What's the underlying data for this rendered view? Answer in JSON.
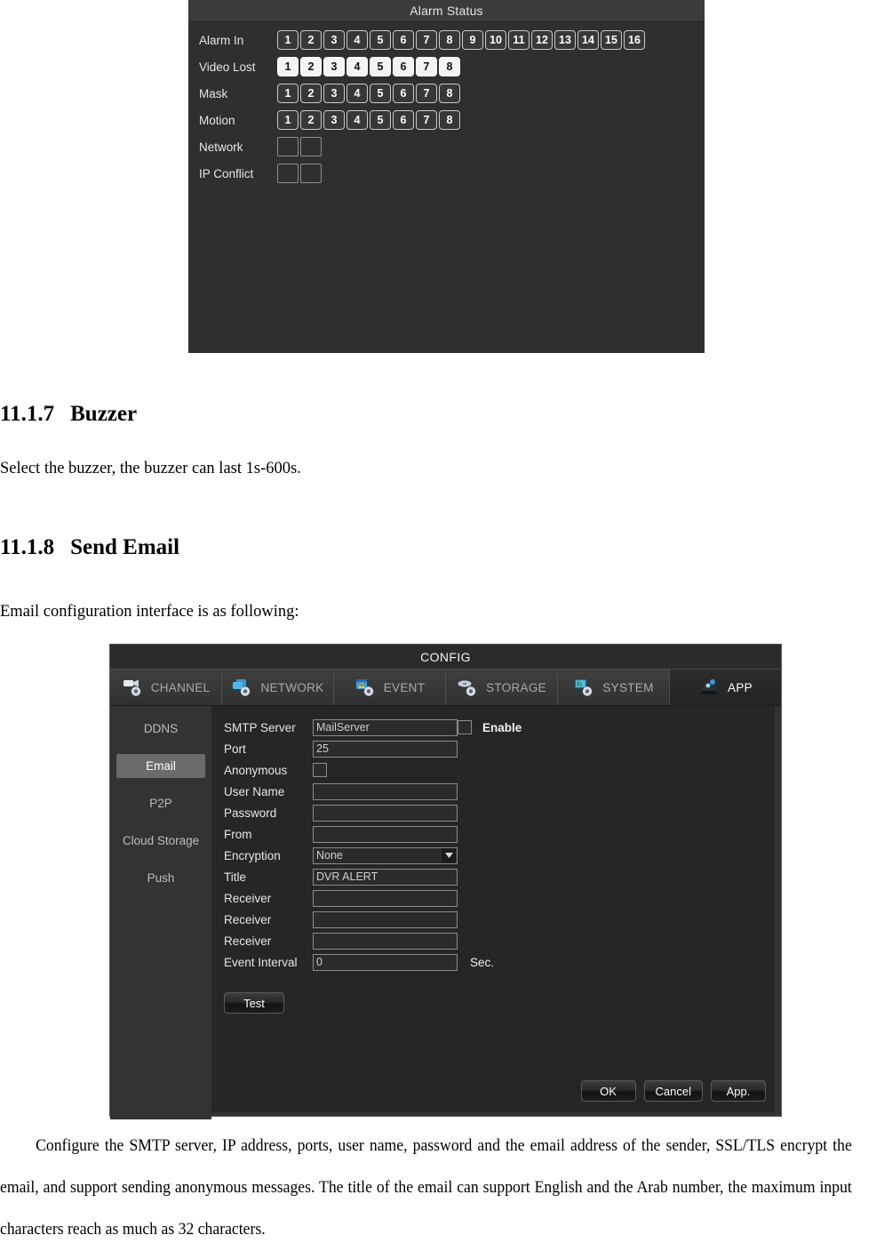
{
  "alarm_status": {
    "title": "Alarm Status",
    "rows": [
      {
        "label": "Alarm In",
        "type": "chips",
        "items": [
          "1",
          "2",
          "3",
          "4",
          "5",
          "6",
          "7",
          "8",
          "9",
          "10",
          "11",
          "12",
          "13",
          "14",
          "15",
          "16"
        ],
        "active": []
      },
      {
        "label": "Video Lost",
        "type": "chips",
        "items": [
          "1",
          "2",
          "3",
          "4",
          "5",
          "6",
          "7",
          "8"
        ],
        "active": [
          1,
          2,
          3,
          4,
          5,
          6,
          7,
          8
        ]
      },
      {
        "label": "Mask",
        "type": "chips",
        "items": [
          "1",
          "2",
          "3",
          "4",
          "5",
          "6",
          "7",
          "8"
        ],
        "active": []
      },
      {
        "label": "Motion",
        "type": "chips",
        "items": [
          "1",
          "2",
          "3",
          "4",
          "5",
          "6",
          "7",
          "8"
        ],
        "active": []
      },
      {
        "label": "Network",
        "type": "blanks",
        "count": 2
      },
      {
        "label": "IP Conflict",
        "type": "blanks",
        "count": 2
      }
    ]
  },
  "document": {
    "section_buzzer": {
      "number": "11.1.7",
      "title": "Buzzer"
    },
    "para_buzzer": "Select the buzzer, the buzzer can last 1s-600s.",
    "section_email": {
      "number": "11.1.8",
      "title": "Send Email"
    },
    "para_email": "Email configuration interface is as following:",
    "closing_para": "Configure the SMTP server, IP address, ports, user name, password and the email address of the sender, SSL/TLS encrypt the email, and support sending anonymous messages. The title of the email can support English and the Arab number, the maximum input characters reach as much as 32 characters."
  },
  "config": {
    "title": "CONFIG",
    "tabs": [
      {
        "label": "CHANNEL",
        "icon": "camera-gear-icon",
        "active": false
      },
      {
        "label": "NETWORK",
        "icon": "network-gear-icon",
        "active": false
      },
      {
        "label": "EVENT",
        "icon": "event-alert-gear-icon",
        "active": false
      },
      {
        "label": "STORAGE",
        "icon": "disk-gear-icon",
        "active": false
      },
      {
        "label": "SYSTEM",
        "icon": "monitor-gear-icon",
        "active": false
      },
      {
        "label": "APP",
        "icon": "app-mobile-icon",
        "active": true
      }
    ],
    "sidebar": [
      {
        "label": "DDNS",
        "active": false
      },
      {
        "label": "Email",
        "active": true
      },
      {
        "label": "P2P",
        "active": false
      },
      {
        "label": "Cloud Storage",
        "active": false
      },
      {
        "label": "Push",
        "active": false
      }
    ],
    "form": {
      "smtp_server_label": "SMTP Server",
      "smtp_server_value": "MailServer",
      "enable_label": "Enable",
      "port_label": "Port",
      "port_value": "25",
      "anonymous_label": "Anonymous",
      "user_name_label": "User Name",
      "user_name_value": "",
      "password_label": "Password",
      "password_value": "",
      "from_label": "From",
      "from_value": "",
      "encryption_label": "Encryption",
      "encryption_value": "None",
      "title_label": "Title",
      "title_value": "DVR ALERT",
      "receiver1_label": "Receiver",
      "receiver1_value": "",
      "receiver2_label": "Receiver",
      "receiver2_value": "",
      "receiver3_label": "Receiver",
      "receiver3_value": "",
      "event_interval_label": "Event Interval",
      "event_interval_value": "0",
      "event_interval_unit": "Sec."
    },
    "buttons": {
      "test": "Test",
      "ok": "OK",
      "cancel": "Cancel",
      "apply": "App."
    }
  },
  "colors": {
    "panel_bg": "#2f2f2f",
    "dialog_bg": "#333333",
    "content_bg": "#262626",
    "accent_selected": "#6b6b6b",
    "chip_on": "#f4f4f4",
    "text": "#e6e6e6"
  }
}
